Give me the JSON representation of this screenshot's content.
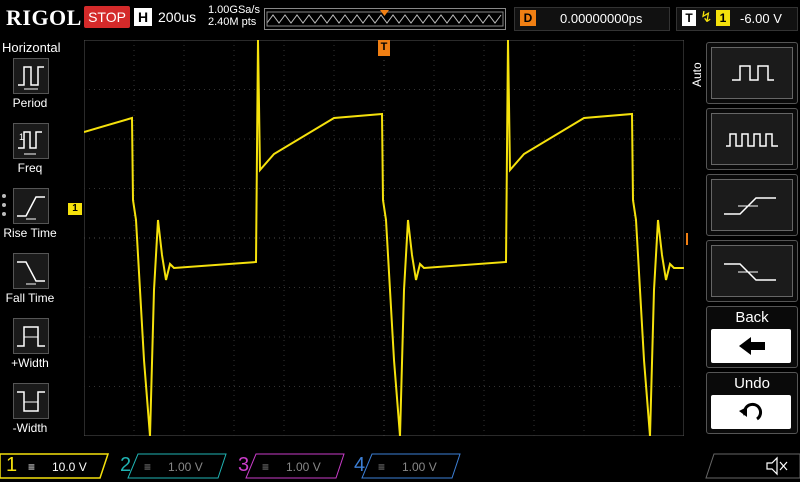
{
  "header": {
    "brand": "RIGOL",
    "run_state": "STOP",
    "timebase_badge": "H",
    "timebase": "200us",
    "sample_rate": "1.00GSa/s",
    "memory_depth": "2.40M pts",
    "delay_badge": "D",
    "delay": "0.00000000ps",
    "trigger_badge": "T",
    "trigger_channel": "1",
    "trigger_level": "-6.00 V",
    "trigger_marker": "T"
  },
  "left_menu": {
    "title": "Horizontal",
    "items": [
      {
        "label": "Period",
        "icon": "period-icon"
      },
      {
        "label": "Freq",
        "icon": "frequency-icon"
      },
      {
        "label": "Rise Time",
        "icon": "rise-time-icon"
      },
      {
        "label": "Fall Time",
        "icon": "fall-time-icon"
      },
      {
        "label": "+Width",
        "icon": "positive-width-icon"
      },
      {
        "label": "-Width",
        "icon": "negative-width-icon"
      }
    ]
  },
  "right_menu": {
    "mode": "Auto",
    "buttons": [
      {
        "label": "",
        "icon": "single-pulse-icon"
      },
      {
        "label": "",
        "icon": "pulse-train-icon"
      },
      {
        "label": "",
        "icon": "rising-edge-icon"
      },
      {
        "label": "",
        "icon": "falling-edge-icon"
      },
      {
        "label": "Back",
        "icon": "back-arrow-icon"
      },
      {
        "label": "Undo",
        "icon": "undo-icon"
      }
    ]
  },
  "channels": [
    {
      "number": "1",
      "scale": "10.0 V",
      "color": "#f5e10c",
      "active": true
    },
    {
      "number": "2",
      "scale": "1.00 V",
      "color": "#1fb3b3",
      "active": false
    },
    {
      "number": "3",
      "scale": "1.00 V",
      "color": "#c93cc9",
      "active": false
    },
    {
      "number": "4",
      "scale": "1.00 V",
      "color": "#3c7fd6",
      "active": false
    }
  ],
  "markers": {
    "channel_marker": "1",
    "trigger_level_marker": "T"
  },
  "colors": {
    "trace": "#f5e10c",
    "trigger": "#f07f13",
    "stop": "#d42a2a"
  }
}
